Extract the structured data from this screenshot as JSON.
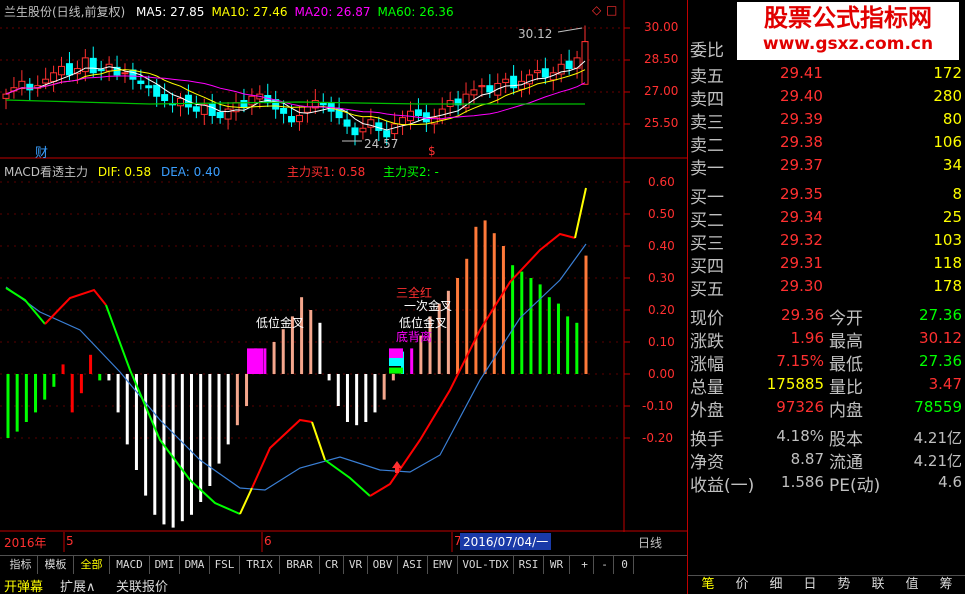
{
  "stock": {
    "title": "兰生股份(日线,前复权)",
    "ma": [
      {
        "label": "MA5: 27.85",
        "color": "#ffffff"
      },
      {
        "label": "MA10: 27.46",
        "color": "#ffff00"
      },
      {
        "label": "MA20: 26.87",
        "color": "#ff00ff"
      },
      {
        "label": "MA60: 26.36",
        "color": "#00ff00"
      }
    ],
    "price_axis": [
      "30.00",
      "28.50",
      "27.00",
      "25.50"
    ],
    "high_mark": "30.12",
    "low_mark": "24.57",
    "cai_label": "财",
    "dollar_mark": "$"
  },
  "macd": {
    "title": "MACD看透主力",
    "dif_label": "DIF: 0.58",
    "dea_label": "DEA: 0.40",
    "zl1_label": "主力买1: 0.58",
    "zl2_label": "主力买2: -",
    "axis": [
      "0.60",
      "0.50",
      "0.40",
      "0.30",
      "0.20",
      "0.10",
      "0.00",
      "-0.10",
      "-0.20"
    ],
    "annotations": {
      "dijinchar1": "低位金叉",
      "dijinchar2": "低位金叉",
      "sanquanhong": "三全红",
      "yici": "一次金叉",
      "dibeili": "底背离"
    },
    "colors": {
      "dif": "#3a7fd5",
      "dea": "#ffff00",
      "red": "#ff0000",
      "green": "#00ff00"
    }
  },
  "timeline": {
    "year": "2016年",
    "m5": "5",
    "m6": "6",
    "m7": "7",
    "cursor_date": "2016/07/04/一",
    "period": "日线"
  },
  "indicator_tabs": [
    "指标",
    "模板",
    "全部",
    "MACD",
    "DMI",
    "DMA",
    "FSL",
    "TRIX",
    "BRAR",
    "CR",
    "VR",
    "OBV",
    "ASI",
    "EMV",
    "VOL-TDX",
    "RSI",
    "WR"
  ],
  "nav_buttons": [
    "+",
    "-",
    "0"
  ],
  "bottom_tabs": [
    "开弹幕",
    "扩展∧",
    "关联报价"
  ],
  "watermark": {
    "line1": "股票公式指标网",
    "line2": "www.gsxz.com.cn"
  },
  "quote": {
    "weibi_label": "委比",
    "asks": [
      {
        "label": "卖五",
        "price": "29.41",
        "vol": "172"
      },
      {
        "label": "卖四",
        "price": "29.40",
        "vol": "280"
      },
      {
        "label": "卖三",
        "price": "29.39",
        "vol": "80"
      },
      {
        "label": "卖二",
        "price": "29.38",
        "vol": "106"
      },
      {
        "label": "卖一",
        "price": "29.37",
        "vol": "34"
      }
    ],
    "bids": [
      {
        "label": "买一",
        "price": "29.35",
        "vol": "8"
      },
      {
        "label": "买二",
        "price": "29.34",
        "vol": "25"
      },
      {
        "label": "买三",
        "price": "29.32",
        "vol": "103"
      },
      {
        "label": "买四",
        "price": "29.31",
        "vol": "118"
      },
      {
        "label": "买五",
        "price": "29.30",
        "vol": "178"
      }
    ],
    "stats": [
      {
        "l1": "现价",
        "v1": "29.36",
        "c1": "#ff3030",
        "l2": "今开",
        "v2": "27.36",
        "c2": "#00ff00"
      },
      {
        "l1": "涨跌",
        "v1": "1.96",
        "c1": "#ff3030",
        "l2": "最高",
        "v2": "30.12",
        "c2": "#ff3030"
      },
      {
        "l1": "涨幅",
        "v1": "7.15%",
        "c1": "#ff3030",
        "l2": "最低",
        "v2": "27.36",
        "c2": "#00ff00"
      },
      {
        "l1": "总量",
        "v1": "175885",
        "c1": "#ffff00",
        "l2": "量比",
        "v2": "3.47",
        "c2": "#ff3030"
      },
      {
        "l1": "外盘",
        "v1": "97326",
        "c1": "#ff3030",
        "l2": "内盘",
        "v2": "78559",
        "c2": "#00ff00"
      }
    ],
    "stats2": [
      {
        "l1": "换手",
        "v1": "4.18%",
        "l2": "股本",
        "v2": "4.21亿"
      },
      {
        "l1": "净资",
        "v1": "8.87",
        "l2": "流通",
        "v2": "4.21亿"
      },
      {
        "l1": "收益(一)",
        "v1": "1.586",
        "l2": "PE(动)",
        "v2": "4.6"
      }
    ]
  },
  "right_tabs": [
    "笔",
    "价",
    "细",
    "日",
    "势",
    "联",
    "值",
    "筹"
  ]
}
